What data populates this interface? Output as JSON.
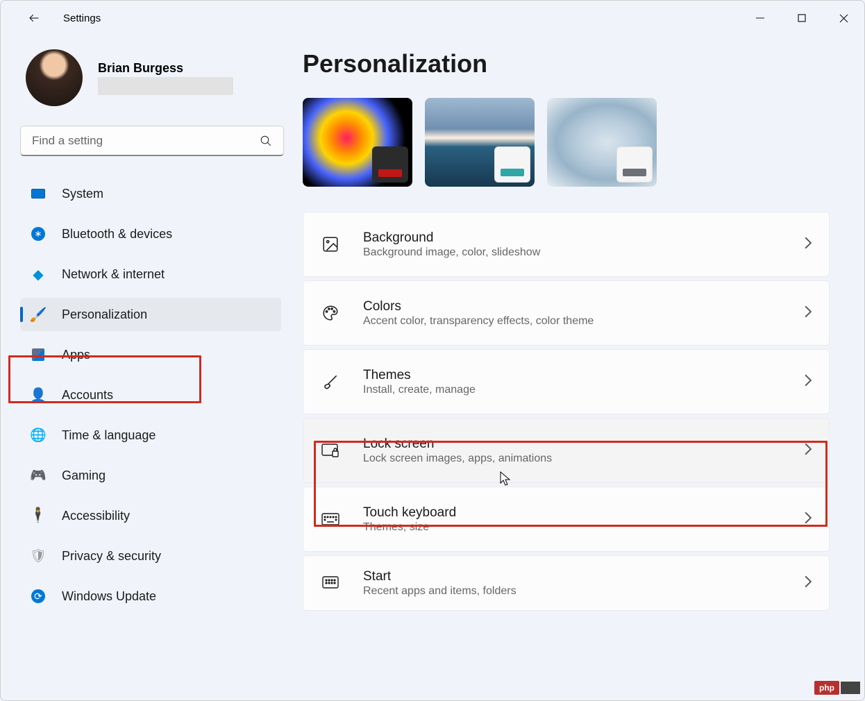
{
  "window": {
    "title": "Settings"
  },
  "profile": {
    "name": "Brian Burgess"
  },
  "search": {
    "placeholder": "Find a setting"
  },
  "nav": {
    "items": [
      {
        "label": "System"
      },
      {
        "label": "Bluetooth & devices"
      },
      {
        "label": "Network & internet"
      },
      {
        "label": "Personalization"
      },
      {
        "label": "Apps"
      },
      {
        "label": "Accounts"
      },
      {
        "label": "Time & language"
      },
      {
        "label": "Gaming"
      },
      {
        "label": "Accessibility"
      },
      {
        "label": "Privacy & security"
      },
      {
        "label": "Windows Update"
      }
    ]
  },
  "page": {
    "title": "Personalization"
  },
  "themes": {
    "colors": [
      "#c21717",
      "#2fa7a7",
      "#6e7078"
    ]
  },
  "cards": [
    {
      "title": "Background",
      "desc": "Background image, color, slideshow"
    },
    {
      "title": "Colors",
      "desc": "Accent color, transparency effects, color theme"
    },
    {
      "title": "Themes",
      "desc": "Install, create, manage"
    },
    {
      "title": "Lock screen",
      "desc": "Lock screen images, apps, animations"
    },
    {
      "title": "Touch keyboard",
      "desc": "Themes, size"
    },
    {
      "title": "Start",
      "desc": "Recent apps and items, folders"
    }
  ],
  "badge": {
    "label": "php"
  }
}
